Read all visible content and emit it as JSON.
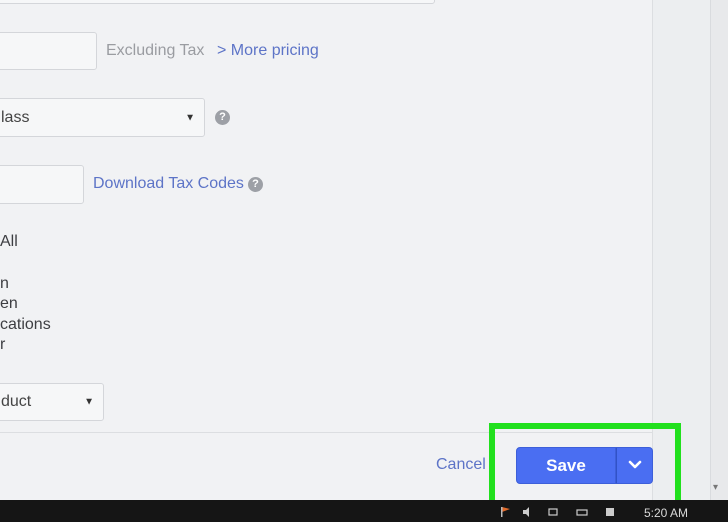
{
  "pricing": {
    "excluding_tax": "Excluding Tax",
    "more_pricing": "More pricing",
    "more_pricing_chevron": ">"
  },
  "tax": {
    "class_value": "lass",
    "download_tax_codes": "Download Tax Codes"
  },
  "visibility": {
    "all": "All",
    "options": [
      "n",
      "en",
      "cations",
      "r"
    ]
  },
  "product_type": {
    "value": "duct"
  },
  "help_icon_glyph": "?",
  "footer": {
    "cancel": "Cancel",
    "save": "Save"
  },
  "taskbar": {
    "clock": "5:20 AM"
  },
  "colors": {
    "primary_button": "#4a6ef2",
    "link": "#5d74c7",
    "highlight": "#21e01d"
  },
  "icons": {
    "dropdown": "chevron-down-icon",
    "help": "question-circle-icon",
    "caret": "triangle-down-icon"
  }
}
